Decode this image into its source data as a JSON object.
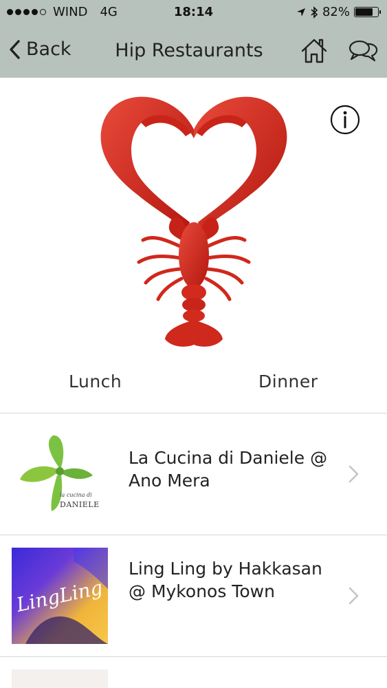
{
  "status_bar": {
    "carrier": "WIND",
    "network": "4G",
    "time": "18:14",
    "battery": "82%",
    "battery_level": 0.82,
    "signal_bars": 4
  },
  "nav": {
    "back_label": "Back",
    "title": "Hip Restaurants",
    "icons": [
      "home-icon",
      "chat-icon"
    ]
  },
  "hero": {
    "image": "lobster-heart-illustration",
    "info_icon": "info-icon"
  },
  "meal_tabs": {
    "lunch": "Lunch",
    "dinner": "Dinner"
  },
  "restaurants": [
    {
      "name": "La Cucina di Daniele @ Ano Mera",
      "thumb": "basil-logo",
      "logo_text_top": "la cucina di",
      "logo_text_bottom": "DANIELE"
    },
    {
      "name": "Ling Ling by Hakkasan @ Mykonos Town",
      "thumb": "ling-ling-photo",
      "logo_text": "LingLing"
    }
  ],
  "colors": {
    "nav_background": "#b8c2bd",
    "lobster_red": "#d62a1e",
    "divider": "#d6d6d6"
  }
}
